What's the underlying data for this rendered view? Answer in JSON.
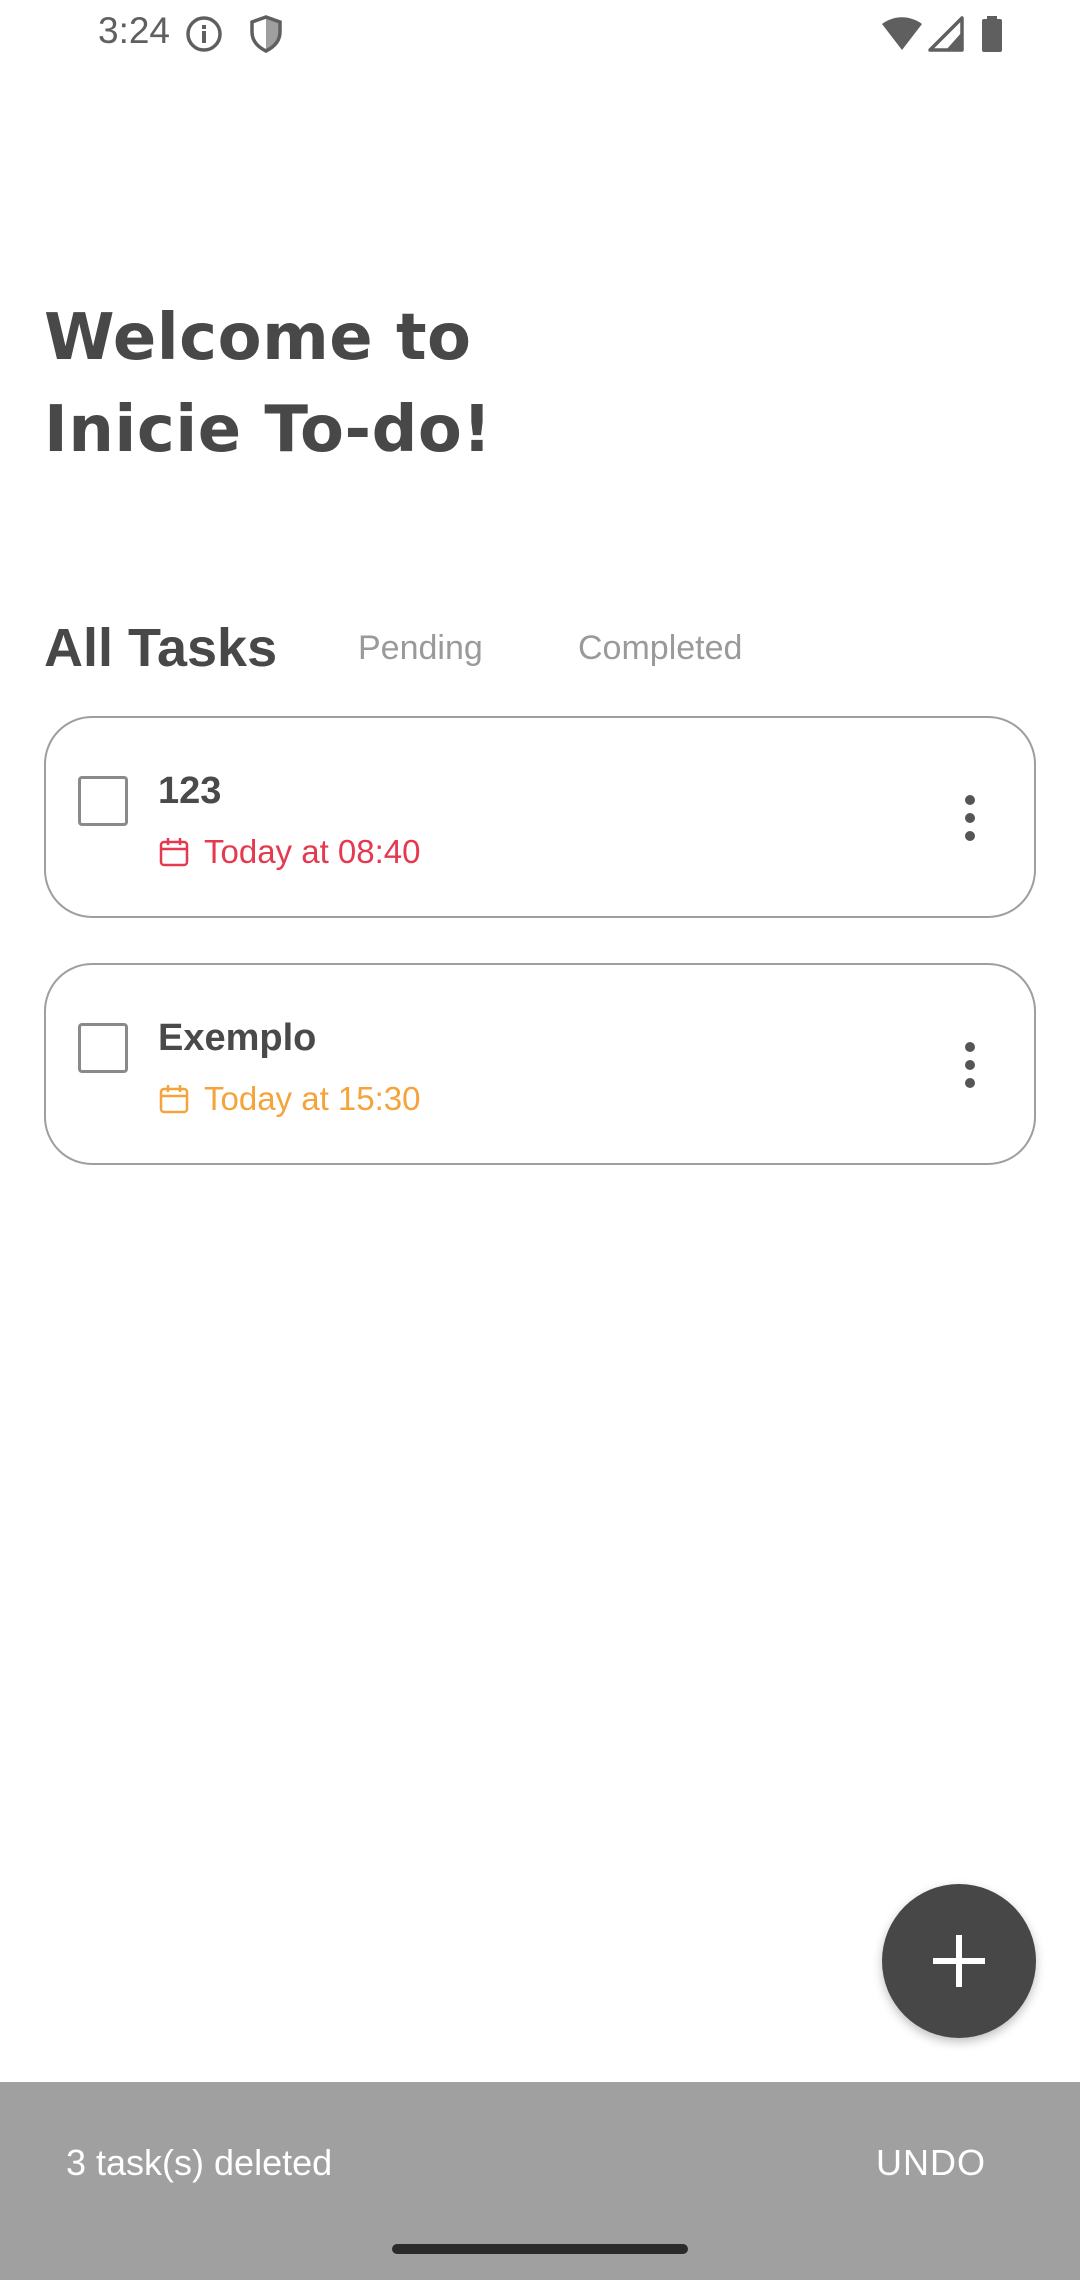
{
  "status_bar": {
    "time": "3:24",
    "left_icons": [
      "info-icon",
      "shield-icon"
    ],
    "right_icons": [
      "wifi-icon",
      "signal-icon",
      "battery-icon"
    ]
  },
  "welcome": {
    "line1": "Welcome to",
    "line2": "Inicie To-do!"
  },
  "tabs": {
    "all": "All Tasks",
    "pending": "Pending",
    "completed": "Completed",
    "selected": "All Tasks"
  },
  "tasks": [
    {
      "title": "123",
      "date": "Today at 08:40",
      "checked": false,
      "date_color": "#e53950",
      "icon": "calendar-icon"
    },
    {
      "title": "Exemplo",
      "date": "Today at 15:30",
      "checked": false,
      "date_color": "#f5a33a",
      "icon": "calendar-icon"
    }
  ],
  "fab": {
    "icon": "plus-icon",
    "color": "#474747"
  },
  "snackbar": {
    "message": "3 task(s) deleted",
    "action": "UNDO"
  },
  "colors": {
    "text_dark": "#484848",
    "tab_inactive": "#9a9a9a",
    "overdue": "#e53950",
    "upcoming": "#f5a33a",
    "snackbar_bg": "#a0a0a0"
  }
}
